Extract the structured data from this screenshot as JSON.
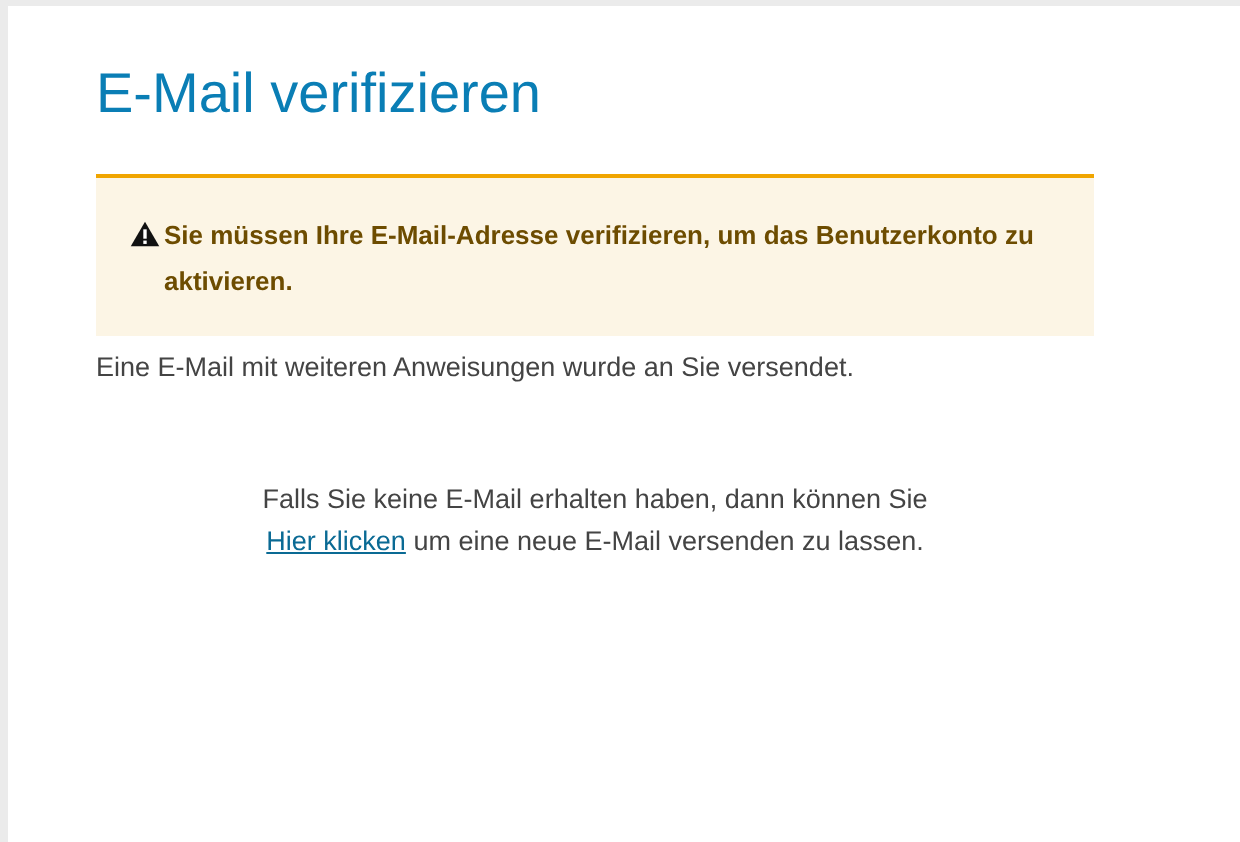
{
  "title": "E-Mail verifizieren",
  "alert": {
    "kind": "warning",
    "text": "Sie müssen Ihre E-Mail-Adresse verifizieren, um das Benutzerkonto zu aktivieren."
  },
  "info": "Eine E-Mail mit weiteren Anweisungen wurde an Sie versendet.",
  "resend": {
    "before": "Falls Sie keine E-Mail erhalten haben, dann können Sie",
    "link": "Hier klicken",
    "after": "um eine neue E-Mail versenden zu lassen."
  }
}
